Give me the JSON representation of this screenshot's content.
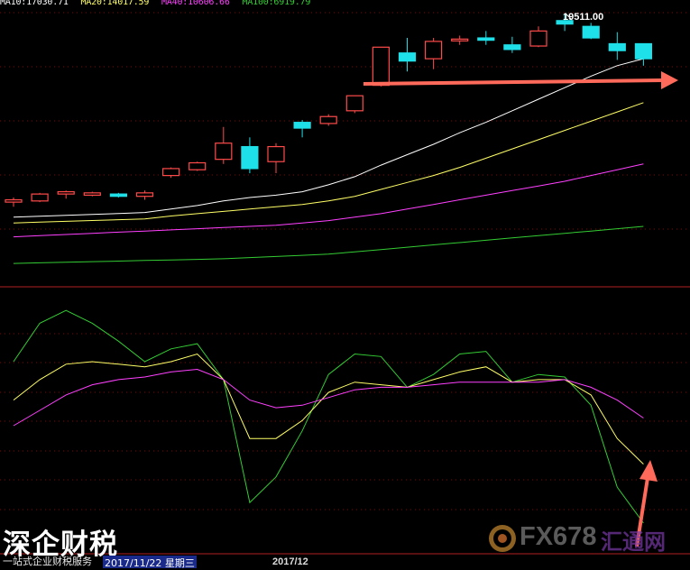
{
  "legend": {
    "ma10": "MA10:17030.71",
    "ma20": "MA20:14017.59",
    "ma40": "MA40:10606.66",
    "ma100": "MA100:6919.79"
  },
  "colors": {
    "background": "#000000",
    "up": "#ff4a4a",
    "down": "#1ee0e8",
    "ma10": "#ffffff",
    "ma20": "#ffff66",
    "ma40": "#ff40ff",
    "ma100": "#33cc33",
    "grid": "#8a0000",
    "arrow": "#ff6a5a"
  },
  "peak_label": "19511.00",
  "date_label": "2017/11/22 星期三",
  "x_tick": "2017/12",
  "watermark": {
    "left_title": "深企财税",
    "left_subtitle": "一站式企业财税服务",
    "right_brand": "FX678",
    "right_brand_cn": "汇通网"
  },
  "chart_data": [
    {
      "type": "candlestick",
      "price_range": [
        -2600,
        20800
      ],
      "candles": [
        {
          "open": 4100,
          "close": 4300,
          "high": 4500,
          "low": 3700
        },
        {
          "open": 4200,
          "close": 4800,
          "high": 4900,
          "low": 4100
        },
        {
          "open": 4800,
          "close": 5000,
          "high": 5100,
          "low": 4400
        },
        {
          "open": 4700,
          "close": 4900,
          "high": 5000,
          "low": 4600
        },
        {
          "open": 4800,
          "close": 4600,
          "high": 4900,
          "low": 4500
        },
        {
          "open": 4600,
          "close": 4900,
          "high": 5100,
          "low": 4300
        },
        {
          "open": 6400,
          "close": 7000,
          "high": 7100,
          "low": 6200
        },
        {
          "open": 6900,
          "close": 7500,
          "high": 7600,
          "low": 6800
        },
        {
          "open": 7800,
          "close": 9200,
          "high": 10600,
          "low": 7400
        },
        {
          "open": 8900,
          "close": 7000,
          "high": 9700,
          "low": 6600
        },
        {
          "open": 7600,
          "close": 8900,
          "high": 9200,
          "low": 6600
        },
        {
          "open": 11000,
          "close": 10500,
          "high": 11200,
          "low": 9700
        },
        {
          "open": 10900,
          "close": 11500,
          "high": 11700,
          "low": 10700
        },
        {
          "open": 12000,
          "close": 13300,
          "high": 13300,
          "low": 11800
        },
        {
          "open": 14200,
          "close": 17500,
          "high": 17500,
          "low": 14100
        },
        {
          "open": 17000,
          "close": 16300,
          "high": 18300,
          "low": 15400
        },
        {
          "open": 16500,
          "close": 18000,
          "high": 18300,
          "low": 15600
        },
        {
          "open": 18200,
          "close": 18200,
          "high": 18500,
          "low": 17700
        },
        {
          "open": 18300,
          "close": 18100,
          "high": 18900,
          "low": 17700
        },
        {
          "open": 17700,
          "close": 17300,
          "high": 18400,
          "low": 17000
        },
        {
          "open": 17600,
          "close": 18900,
          "high": 19300,
          "low": 17500
        },
        {
          "open": 19800,
          "close": 19500,
          "high": 20400,
          "low": 18900
        },
        {
          "open": 19300,
          "close": 18300,
          "high": 19600,
          "low": 18200
        },
        {
          "open": 17800,
          "close": 17200,
          "high": 18800,
          "low": 16400
        },
        {
          "open": 17800,
          "close": 16500,
          "high": 17800,
          "low": 15900
        }
      ],
      "moving_averages": [
        {
          "name": "MA10",
          "values": [
            2800,
            2880,
            2960,
            3040,
            3120,
            3200,
            3500,
            3800,
            4200,
            4500,
            4700,
            5000,
            5600,
            6300,
            7300,
            8200,
            9100,
            10100,
            11000,
            12000,
            13000,
            14000,
            15000,
            15900,
            16500
          ]
        },
        {
          "name": "MA20",
          "values": [
            2300,
            2370,
            2440,
            2510,
            2580,
            2650,
            2900,
            3100,
            3300,
            3500,
            3700,
            3900,
            4200,
            4600,
            5200,
            5800,
            6400,
            7100,
            7900,
            8700,
            9500,
            10300,
            11100,
            11900,
            12700
          ]
        },
        {
          "name": "MA40",
          "values": [
            1100,
            1200,
            1300,
            1400,
            1500,
            1600,
            1700,
            1800,
            1900,
            2000,
            2100,
            2300,
            2500,
            2800,
            3100,
            3500,
            3900,
            4300,
            4700,
            5100,
            5500,
            5900,
            6400,
            6900,
            7400
          ]
        },
        {
          "name": "MA100",
          "values": [
            -1200,
            -1150,
            -1100,
            -1050,
            -1000,
            -950,
            -900,
            -850,
            -800,
            -700,
            -600,
            -500,
            -400,
            -200,
            0,
            200,
            400,
            600,
            800,
            1000,
            1200,
            1400,
            1600,
            1800,
            2000
          ]
        }
      ]
    },
    {
      "type": "line",
      "y_range": [
        0,
        100
      ],
      "series": [
        {
          "values": [
            75,
            90,
            95,
            90,
            83,
            75,
            80,
            82,
            68,
            20,
            30,
            48,
            70,
            78,
            77,
            65,
            70,
            78,
            79,
            67,
            70,
            69,
            58,
            26,
            12
          ]
        },
        {
          "values": [
            60,
            68,
            74,
            75,
            74,
            73,
            75,
            78,
            68,
            45,
            45,
            52,
            63,
            67,
            66,
            65,
            68,
            71,
            73,
            67,
            68,
            68,
            62,
            45,
            35
          ]
        },
        {
          "values": [
            50,
            56,
            62,
            66,
            68,
            69,
            71,
            72,
            68,
            60,
            57,
            58,
            61,
            64,
            65,
            65,
            66,
            67,
            67,
            67,
            67,
            68,
            65,
            60,
            53
          ]
        }
      ]
    }
  ]
}
